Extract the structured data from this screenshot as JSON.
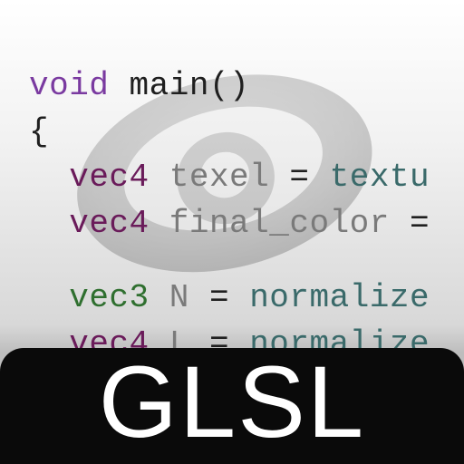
{
  "code": {
    "line1": {
      "kw": "void",
      "fn": "main()"
    },
    "brace_open": "{",
    "line2": {
      "type": "vec4",
      "ident": "texel",
      "eq": "=",
      "rhs": "textu"
    },
    "line3": {
      "type": "vec4",
      "ident": "final_color",
      "eq": "=",
      "rhs": ""
    },
    "line4": {
      "type": "vec3",
      "ident": "N",
      "eq": "=",
      "rhs": "normalize"
    },
    "line5": {
      "type": "vec4",
      "ident": "L",
      "eq": "=",
      "rhs": "normalize"
    }
  },
  "band": {
    "label": "GLSL"
  },
  "logo": {
    "name": "disc-ring-logo"
  },
  "colors": {
    "void": "#7a3aa0",
    "vec4": "#6a1b5a",
    "vec3": "#2f6f2f",
    "ident": "#7a7a7a",
    "call": "#3a6a6a",
    "band_bg": "#0a0a0a",
    "band_fg": "#ffffff"
  }
}
